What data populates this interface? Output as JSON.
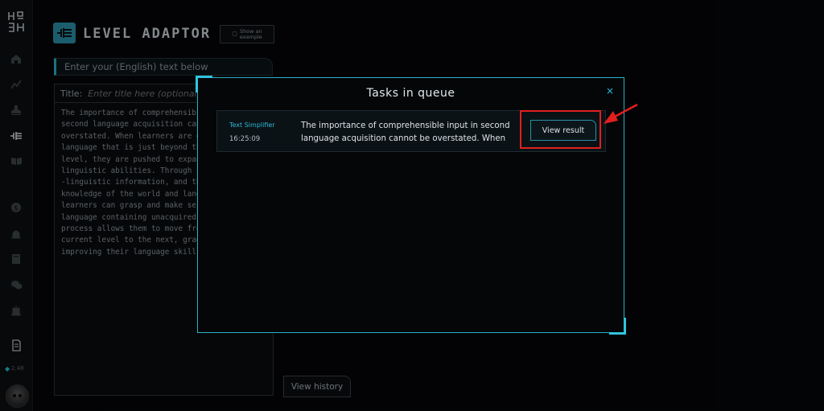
{
  "app": {
    "title": "LEVEL ADAPTOR",
    "example_button": {
      "line1": "Show an",
      "line2": "example"
    }
  },
  "sidebar": {
    "credits": "2,48",
    "icons": [
      "home-icon",
      "chart-icon",
      "stamp-icon",
      "level-adaptor-icon",
      "book-icon",
      "help-icon",
      "hat-icon",
      "note-icon",
      "chat-icon",
      "bot-icon",
      "document-icon"
    ]
  },
  "editor": {
    "input_label": "Enter your (English) text below",
    "title_label": "Title:",
    "title_placeholder": "Enter title here (optional)",
    "body": "The importance of comprehensible\nsecond language acquisition can\noverstated. When learners are e\nlanguage that is just beyond th\nlevel, they are pushed to expan\nlinguistic abilities. Through c\n-linguistic information, and th\nknowledge of the world and lang\nlearners can grasp and make ser\nlanguage containing unacquired\nprocess allows them to move fro\ncurrent level to the next, grad\nimproving their language skills"
  },
  "history_button": "View history",
  "modal": {
    "title": "Tasks in queue",
    "close_label": "×",
    "tasks": [
      {
        "type": "Text Simplifier",
        "time": "16:25:09",
        "text": "The importance of comprehensible input in second language acquisition cannot be overstated. When",
        "action": "View result"
      }
    ]
  },
  "annotation": {
    "highlight_color": "#e0201f"
  },
  "colors": {
    "accent": "#2bb0c8",
    "background": "#050608"
  }
}
